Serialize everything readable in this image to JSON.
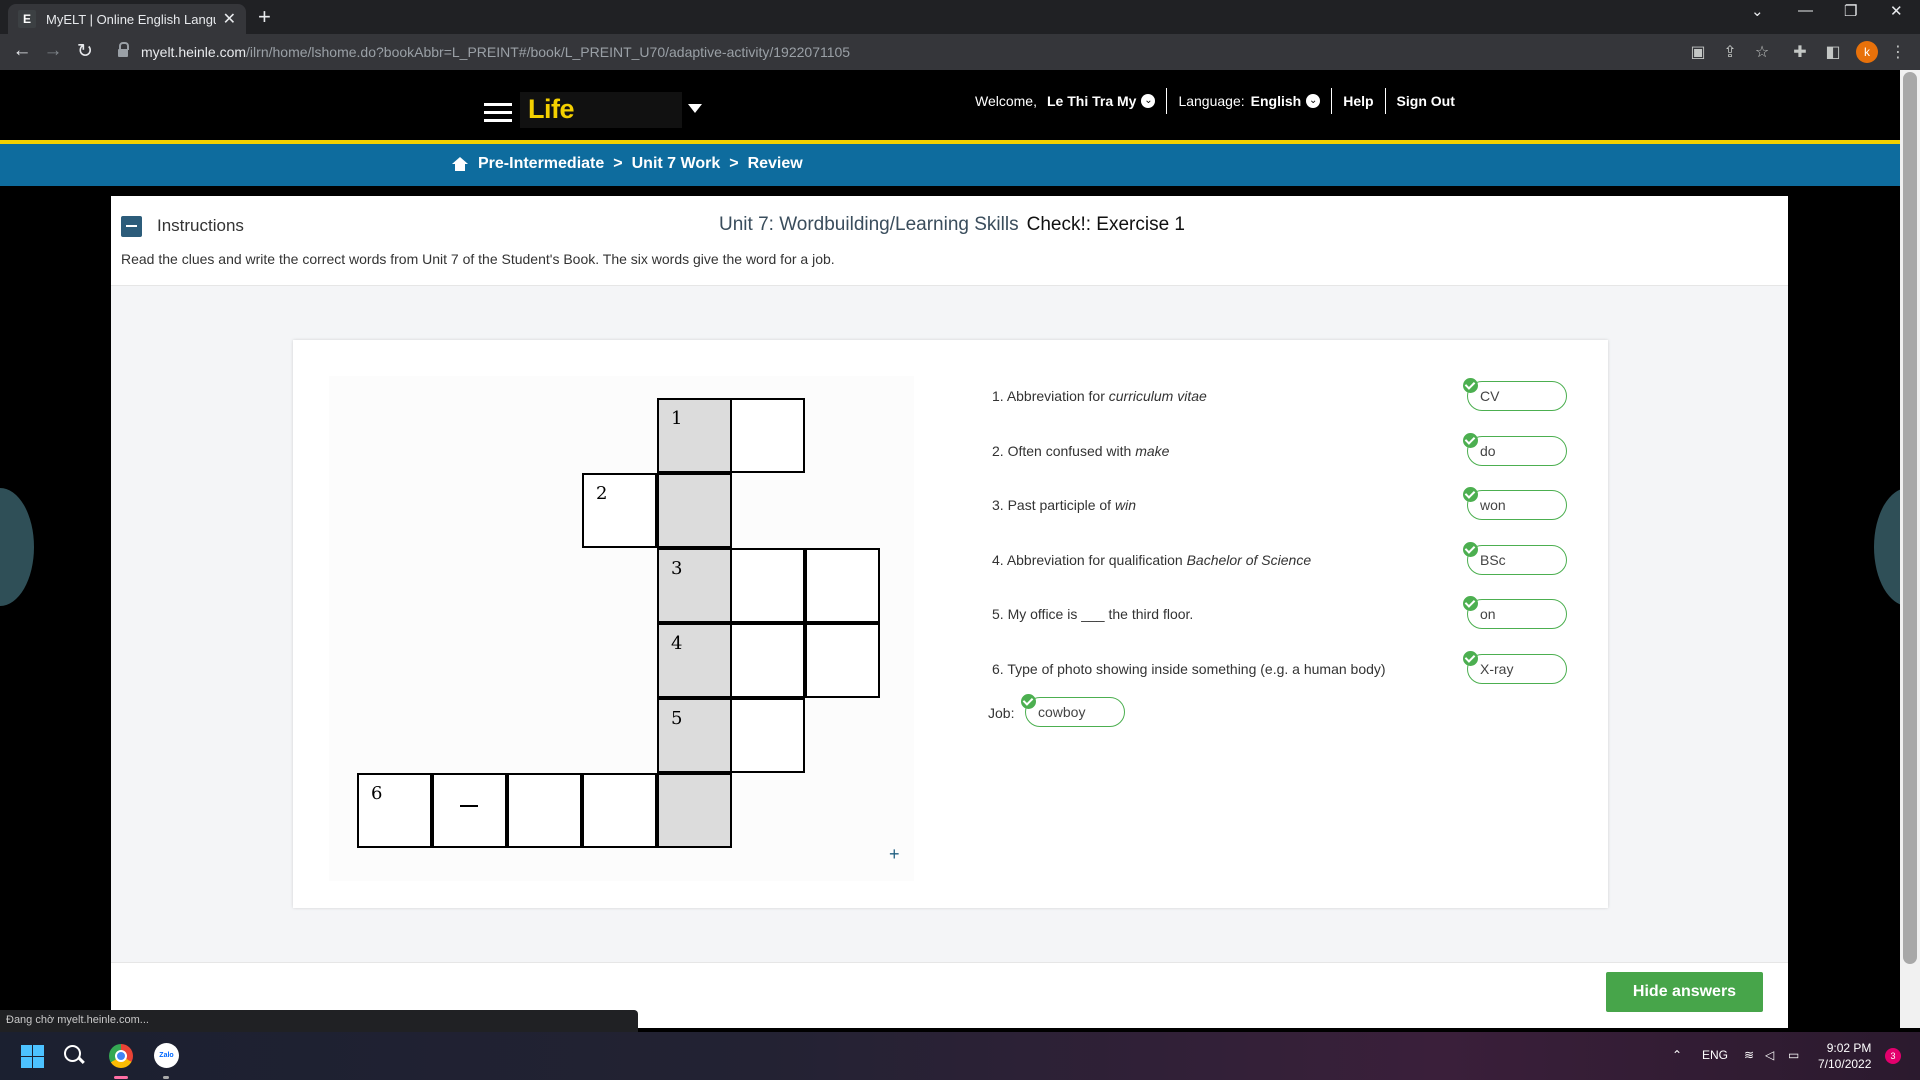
{
  "browser": {
    "tab_favicon": "E",
    "tab_title": "MyELT | Online English Language",
    "url_domain": "myelt.heinle.com",
    "url_path": "/ilrn/home/lshome.do?bookAbbr=L_PREINT#/book/L_PREINT_U70/adaptive-activity/1922071105",
    "profile_initial": "k",
    "status_text": "Đang chờ myelt.heinle.com..."
  },
  "header": {
    "brand": "Life",
    "welcome_label": "Welcome,",
    "user_name": "Le Thi Tra My",
    "language_label": "Language:",
    "language_value": "English",
    "help": "Help",
    "sign_out": "Sign Out"
  },
  "breadcrumb": {
    "level": "Pre-Intermediate",
    "unit": "Unit 7 Work",
    "page": "Review"
  },
  "activity": {
    "instructions_label": "Instructions",
    "title": "Unit 7: Wordbuilding/Learning Skills",
    "subtitle": "Check!: Exercise 1",
    "instructions_text": "Read the clues and write the correct words from Unit 7 of the Student's Book. The six words give the word for a job.",
    "crossword_numbers": [
      "1",
      "2",
      "3",
      "4",
      "5",
      "6"
    ],
    "plus_label": "+",
    "clues": [
      {
        "num": "1.",
        "pre": "Abbreviation for ",
        "em": "curriculum vitae",
        "post": "",
        "answer": "CV"
      },
      {
        "num": "2.",
        "pre": "Often confused with ",
        "em": "make",
        "post": "",
        "answer": "do"
      },
      {
        "num": "3.",
        "pre": "Past participle of ",
        "em": "win",
        "post": "",
        "answer": "won"
      },
      {
        "num": "4.",
        "pre": "Abbreviation for qualification ",
        "em": "Bachelor of Science",
        "post": "",
        "answer": "BSc"
      },
      {
        "num": "5.",
        "pre": "My office is ___ the third floor.",
        "em": "",
        "post": "",
        "answer": "on"
      },
      {
        "num": "6.",
        "pre": "Type of photo showing inside something (e.g. a human body)",
        "em": "",
        "post": "",
        "answer": "X-ray"
      }
    ],
    "job_label": "Job:",
    "job_answer": "cowboy",
    "hide_answers": "Hide answers"
  },
  "taskbar": {
    "zalo_label": "Zalo",
    "lang": "ENG",
    "time": "9:02 PM",
    "date": "7/10/2022",
    "notifications": "3"
  },
  "colors": {
    "brand_yellow": "#f4d000",
    "breadcrumb_blue": "#0e6c9e",
    "correct_green": "#4caf50",
    "button_green": "#47a54a"
  }
}
